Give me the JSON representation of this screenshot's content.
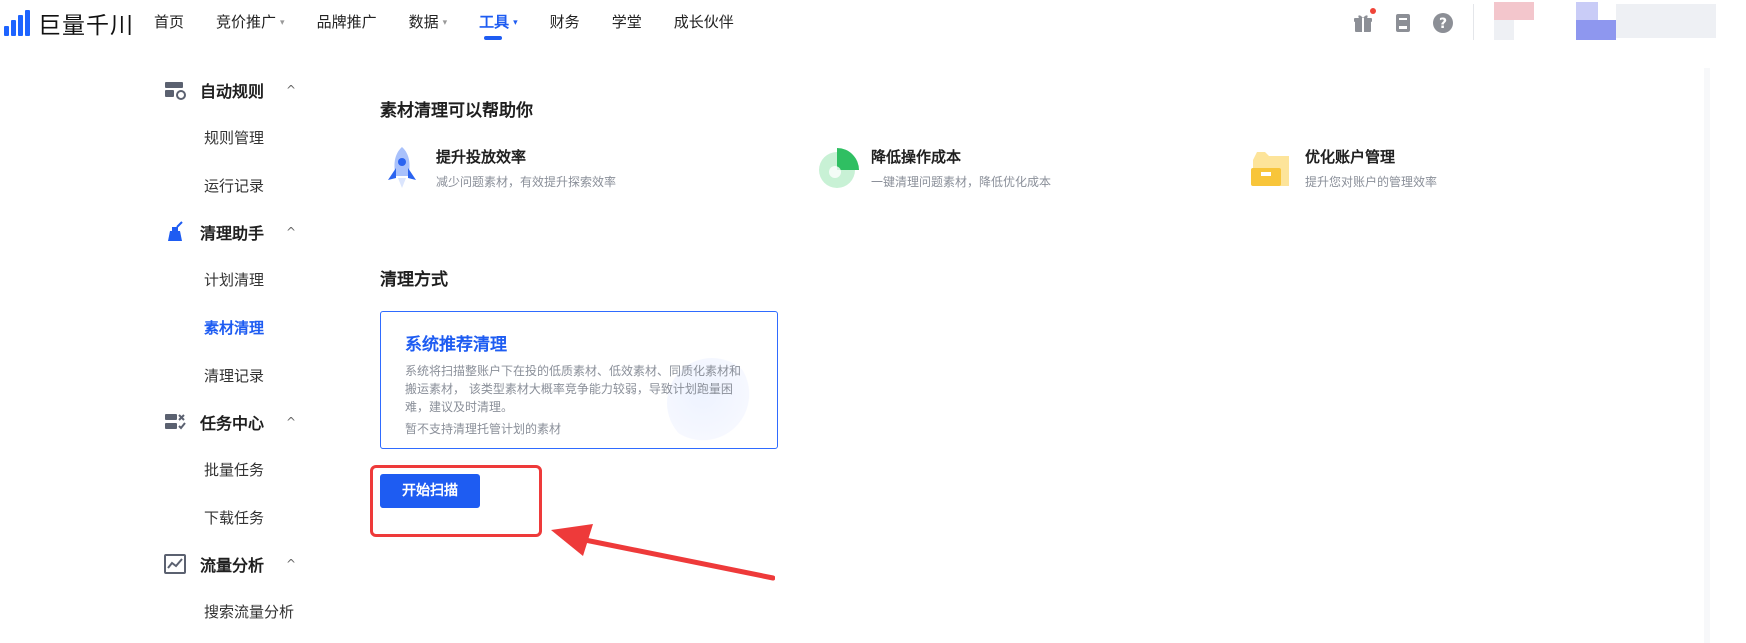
{
  "app": {
    "name": "巨量千川"
  },
  "nav": {
    "items": [
      {
        "label": "首页",
        "has_caret": false,
        "active": false
      },
      {
        "label": "竞价推广",
        "has_caret": true,
        "active": false
      },
      {
        "label": "品牌推广",
        "has_caret": false,
        "active": false
      },
      {
        "label": "数据",
        "has_caret": true,
        "active": false
      },
      {
        "label": "工具",
        "has_caret": true,
        "active": true
      },
      {
        "label": "财务",
        "has_caret": false,
        "active": false
      },
      {
        "label": "学堂",
        "has_caret": false,
        "active": false
      },
      {
        "label": "成长伙伴",
        "has_caret": false,
        "active": false
      }
    ],
    "caret": "▾",
    "icons": [
      "gift-icon",
      "document-icon",
      "help-icon"
    ],
    "notification_dot_color": "#f04438"
  },
  "sidebar": {
    "chevron": "^",
    "groups": [
      {
        "label": "自动规则",
        "icon": "auto-rule-icon",
        "items": [
          "规则管理",
          "运行记录"
        ]
      },
      {
        "label": "清理助手",
        "icon": "broom-icon",
        "items": [
          "计划清理",
          "素材清理",
          "清理记录"
        ]
      },
      {
        "label": "任务中心",
        "icon": "task-center-icon",
        "items": [
          "批量任务",
          "下载任务"
        ]
      },
      {
        "label": "流量分析",
        "icon": "traffic-chart-icon",
        "items": [
          "搜索流量分析"
        ]
      }
    ],
    "active_item": "素材清理"
  },
  "main": {
    "intro_title": "素材清理可以帮助你",
    "features": [
      {
        "title": "提升投放效率",
        "desc": "减少问题素材，有效提升探索效率",
        "icon": "rocket-icon"
      },
      {
        "title": "降低操作成本",
        "desc": "一键清理问题素材，降低优化成本",
        "icon": "pie-chart-icon"
      },
      {
        "title": "优化账户管理",
        "desc": "提升您对账户的管理效率",
        "icon": "folder-icon"
      }
    ],
    "method_title": "清理方式",
    "method_card": {
      "title": "系统推荐清理",
      "desc": "系统将扫描整账户下在投的低质素材、低效素材、同质化素材和搬运素材， 该类型素材大概率竞争能力较弱，导致计划跑量困难，建议及时清理。",
      "note": "暂不支持清理托管计划的素材"
    },
    "scan_button": "开始扫描"
  },
  "colors": {
    "accent": "#1e5cf2",
    "annotation_red": "#ee3a3a"
  }
}
